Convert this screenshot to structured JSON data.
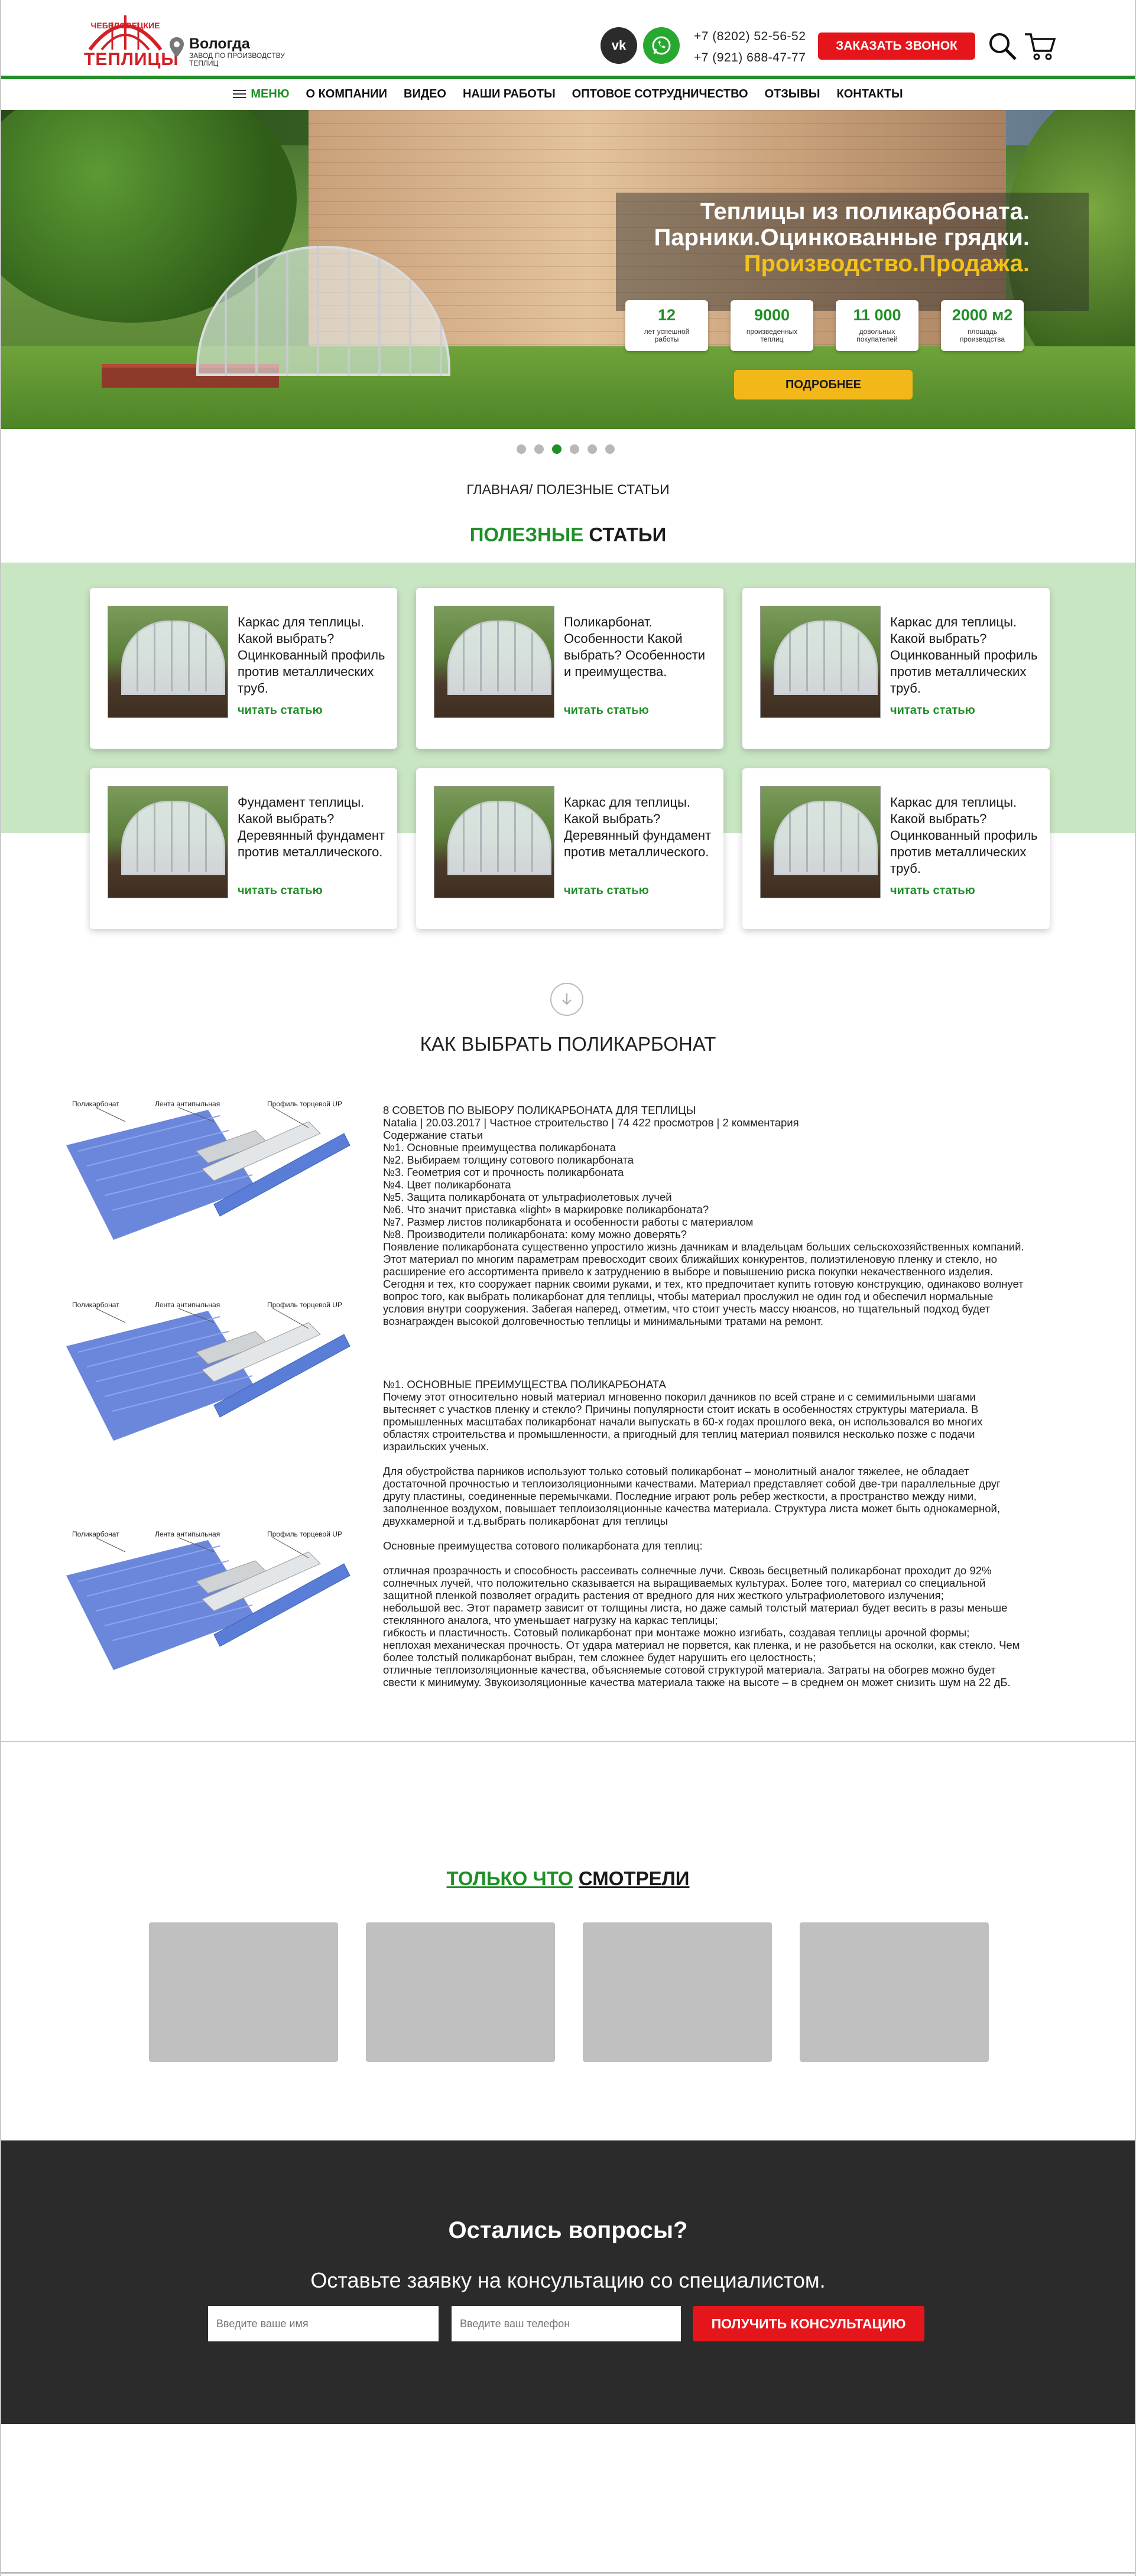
{
  "header": {
    "logo_top": "ЧЕБЕЛОВЕЦКИЕ",
    "logo_bottom": "ТЕПЛИЦЫ",
    "city": "Вологда",
    "city_sub": "ЗАВОД ПО ПРОИЗВОДСТВУ ТЕПЛИЦ",
    "vk_label": "vk",
    "phone1": "+7 (8202) 52-56-52",
    "phone2": "+7 (921) 688-47-77",
    "callback_label": "ЗАКАЗАТЬ ЗВОНОК",
    "search_icon": "search-icon",
    "cart_icon": "cart-icon"
  },
  "nav": {
    "menu": "МЕНЮ",
    "items": [
      "О КОМПАНИИ",
      "ВИДЕО",
      "НАШИ РАБОТЫ",
      "ОПТОВОЕ СОТРУДНИЧЕСТВО",
      "ОТЗЫВЫ",
      "КОНТАКТЫ"
    ]
  },
  "hero": {
    "line1": "Теплицы из поликарбоната.",
    "line2": "Парники.Оцинкованные грядки.",
    "line3": "Производство.Продажа.",
    "stats": [
      {
        "num": "12",
        "label": "лет успешной работы"
      },
      {
        "num": "9000",
        "label": "произведенных теплиц"
      },
      {
        "num": "11 000",
        "label": "довольных покупателей"
      },
      {
        "num": "2000 м2",
        "label": "площадь производства"
      }
    ],
    "more_label": "ПОДРОБНЕЕ",
    "slides_total": 6,
    "active_slide": 3
  },
  "breadcrumb": "ГЛАВНАЯ/ ПОЛЕЗНЫЕ СТАТЬИ",
  "useful": {
    "title_green": "ПОЛЕЗНЫЕ",
    "title_dark": "СТАТЬИ",
    "cards": [
      {
        "title": "Каркас для теплицы. Какой выбрать? Оцинкованный профиль против металлических труб.",
        "link": "читать статью"
      },
      {
        "title": "Поликарбонат. Особенности Какой выбрать? Особенности и преимущества.",
        "link": "читать статью"
      },
      {
        "title": "Каркас для теплицы. Какой выбрать? Оцинкованный профиль против металлических труб.",
        "link": "читать статью"
      },
      {
        "title": "Фундамент теплицы. Какой выбрать? Деревянный фундамент против металлического.",
        "link": "читать статью"
      },
      {
        "title": "Каркас для теплицы. Какой выбрать? Деревянный фундамент против металлического.",
        "link": "читать статью"
      },
      {
        "title": "Каркас для теплицы. Какой выбрать? Оцинкованный профиль против металлических труб.",
        "link": "читать статью"
      }
    ]
  },
  "article": {
    "heading": "КАК ВЫБРАТЬ ПОЛИКАРБОНАТ",
    "diagram_labels": [
      "Поликарбонат",
      "Лента антипыльная",
      "Профиль торцевой UP"
    ],
    "block1": [
      "8 СОВЕТОВ ПО ВЫБОРУ ПОЛИКАРБОНАТА ДЛЯ ТЕПЛИЦЫ",
      "Natalia | 20.03.2017 | Частное строительство | 74 422 просмотров | 2 комментария",
      "Содержание статьи",
      "№1. Основные преимущества поликарбоната",
      "№2. Выбираем толщину сотового поликарбоната",
      "№3. Геометрия сот и прочность поликарбоната",
      "№4. Цвет поликарбоната",
      "№5. Защита поликарбоната от ультрафиолетовых лучей",
      "№6. Что значит приставка «light» в маркировке поликарбоната?",
      "№7. Размер листов поликарбоната и особенности работы с материалом",
      "№8. Производители поликарбоната: кому можно доверять?",
      "Появление поликарбоната существенно упростило жизнь дачникам и владельцам больших сельскохозяйственных компаний. Этот материал по многим параметрам превосходит своих ближайших конкурентов, полиэтиленовую пленку и стекло, но расширение его ассортимента привело к затруднению в выборе и повышению риска покупки некачественного изделия. Сегодня и тех, кто сооружает парник своими руками, и тех, кто предпочитает купить готовую конструкцию, одинаково волнует вопрос того, как выбрать поликарбонат для теплицы, чтобы материал прослужил не один год и обеспечил нормальные условия внутри сооружения. Забегая наперед, отметим, что стоит учесть массу нюансов, но тщательный подход будет вознагражден высокой долговечностью теплицы и минимальными тратами на ремонт."
    ],
    "block2": [
      "№1. ОСНОВНЫЕ ПРЕИМУЩЕСТВА ПОЛИКАРБОНАТА",
      "Почему этот относительно новый материал мгновенно покорил дачников по всей стране и с семимильными шагами вытесняет с участков пленку и стекло? Причины популярности стоит искать в особенностях структуры материала. В промышленных масштабах поликарбонат начали выпускать в 60-х годах прошлого века, он использовался во многих областях строительства и промышленности, а пригодный для теплиц материал появился несколько позже с подачи израильских ученых.",
      "",
      "Для обустройства парников используют только сотовый поликарбонат – монолитный аналог тяжелее, не обладает достаточной прочностью и теплоизоляционными качествами. Материал представляет собой две-три параллельные друг другу пластины, соединенные перемычками. Последние играют роль ребер жесткости, а пространство между ними, заполненное воздухом, повышает теплоизоляционные качества материала. Структура листа может быть однокамерной, двухкамерной и т.д.выбрать поликарбонат для теплицы",
      "",
      "Основные преимущества сотового поликарбоната для теплиц:",
      "",
      "отличная прозрачность и способность рассеивать солнечные лучи. Сквозь бесцветный поликарбонат проходит до 92% солнечных лучей, что положительно сказывается на выращиваемых культурах. Более того, материал со специальной защитной пленкой позволяет оградить растения от вредного для них жесткого ультрафиолетового излучения;",
      "небольшой вес. Этот параметр зависит от толщины листа, но даже самый толстый материал будет весить в разы меньше стеклянного аналога, что уменьшает нагрузку на каркас теплицы;",
      "гибкость и пластичность. Сотовый поликарбонат при монтаже можно изгибать, создавая теплицы арочной формы;",
      "неплохая механическая прочность. От удара материал не порвется, как пленка, и не разобьется на осколки, как стекло. Чем более толстый поликарбонат выбран, тем сложнее будет нарушить его целостность;",
      "отличные теплоизоляционные качества, объясняемые сотовой структурой материала. Затраты на обогрев можно будет свести к минимуму. Звукоизоляционные качества материала также на высоте – в среднем он может снизить шум на 22 дБ."
    ]
  },
  "recent": {
    "title_green": "ТОЛЬКО ЧТО",
    "title_dark": "СМОТРЕЛИ"
  },
  "footer": {
    "title": "Остались вопросы?",
    "subtitle": "Оставьте заявку на консультацию со специалистом.",
    "name_placeholder": "Введите ваше имя",
    "phone_placeholder": "Введите ваш телефон",
    "button": "ПОЛУЧИТЬ КОНСУЛЬТАЦИЮ"
  },
  "colors": {
    "accent_green": "#1f8f26",
    "accent_red": "#e5161b",
    "accent_yellow": "#f2b81a",
    "band_green": "#c9e6c3",
    "footer_bg": "#2b2b2b"
  }
}
